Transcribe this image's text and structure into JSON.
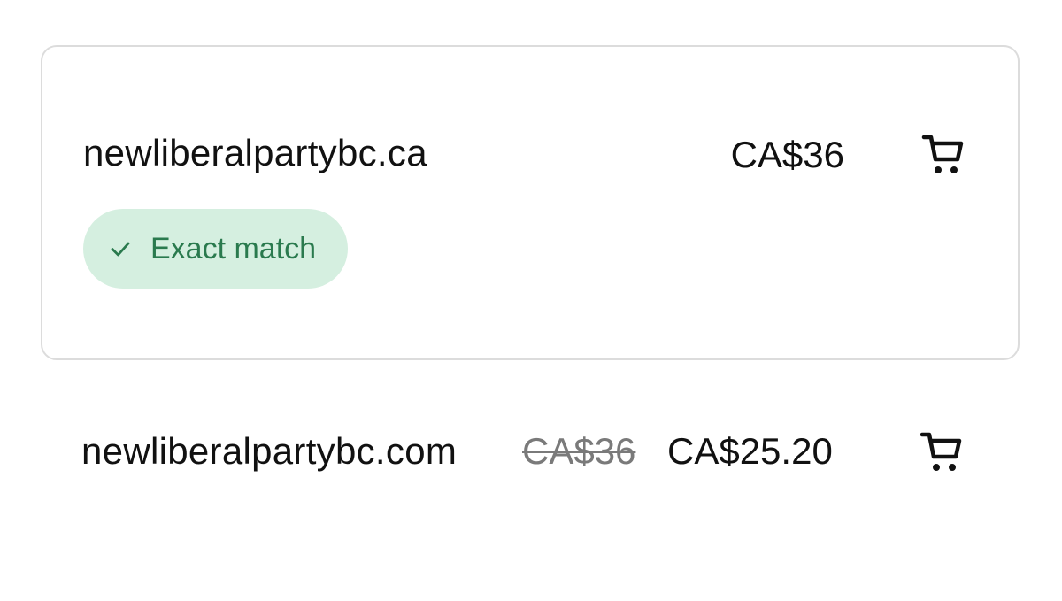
{
  "results": [
    {
      "domain": "newliberalpartybc.ca",
      "price": "CA$36",
      "badge": "Exact match",
      "cart_icon": "cart-icon",
      "badge_icon": "check-icon"
    },
    {
      "domain": "newliberalpartybc.com",
      "original_price": "CA$36",
      "price": "CA$25.20",
      "cart_icon": "cart-icon"
    }
  ],
  "colors": {
    "badge_background": "#d5efe0",
    "badge_text": "#2a7a4e",
    "card_border": "#dcdcdc",
    "strikethrough_price": "#7a7a7a",
    "text": "#111111"
  }
}
